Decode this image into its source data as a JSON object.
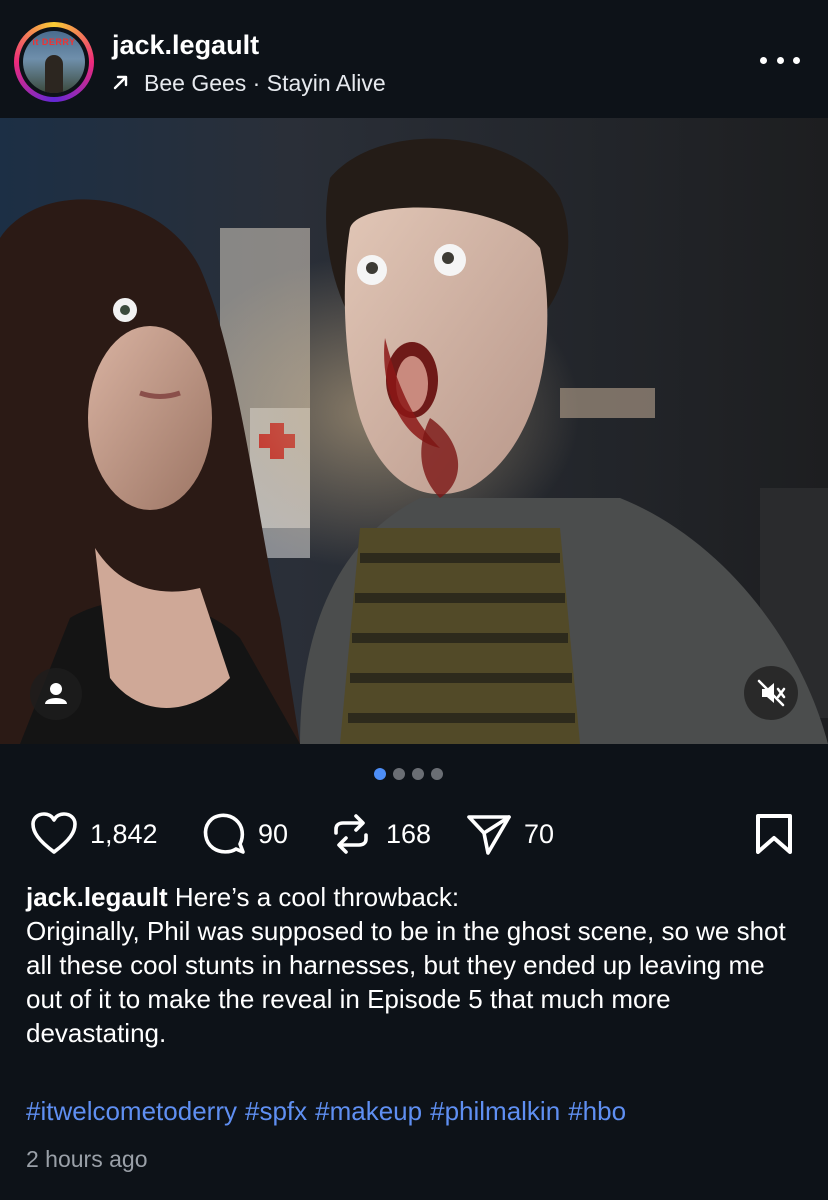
{
  "post": {
    "username": "jack.legault",
    "music": {
      "icon": "arrow-up-right-icon",
      "text": "Bee Gees · Stayin Alive"
    },
    "avatar_logo_text": "it DERRY",
    "menu_icon": "more-horizontal-icon"
  },
  "media": {
    "description_icon": "user-tag-icon",
    "mute_icon": "volume-muted-icon",
    "carousel": {
      "total": 4,
      "active_index": 0
    }
  },
  "actions": {
    "likes": "1,842",
    "comments": "90",
    "reposts": "168",
    "shares": "70"
  },
  "caption": {
    "username": "jack.legault",
    "line1": " Here’s a cool throwback:",
    "body": "Originally, Phil was supposed to be in the ghost scene, so we shot all these cool stunts in harnesses, but they ended up leaving me out of it to make the reveal in Episode 5 that much more devastating."
  },
  "hashtags": [
    "#itwelcometoderry",
    "#spfx",
    "#makeup",
    "#philmalkin",
    "#hbo"
  ],
  "timestamp": "2 hours ago",
  "colors": {
    "background": "#0d1218",
    "link": "#5f8ff2",
    "carousel_active": "#4d8ef7",
    "muted_text": "#9aa0a8"
  }
}
